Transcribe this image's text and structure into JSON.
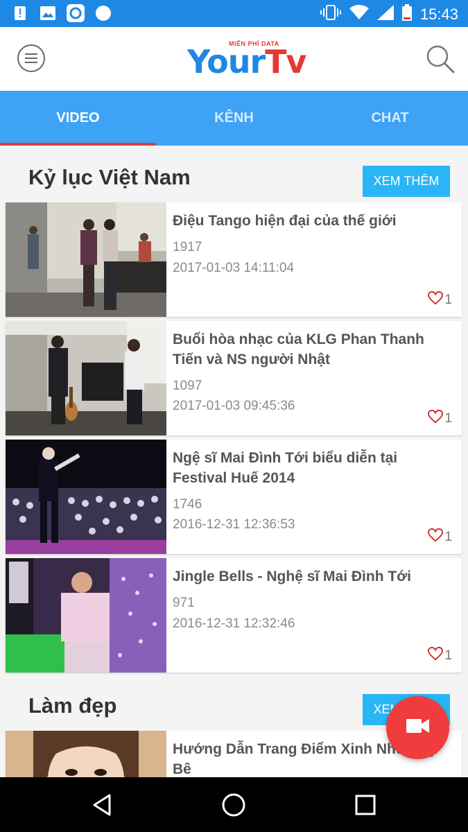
{
  "statusbar": {
    "time": "15:43",
    "left_icons": [
      "alert-icon",
      "image-icon",
      "app-icon",
      "circle-icon"
    ],
    "right_icons": [
      "vibrate-icon",
      "wifi-icon",
      "signal-icon",
      "battery-icon"
    ]
  },
  "appbar": {
    "logo_tag": "MIỄN PHÍ DATA",
    "logo_your": "Your",
    "logo_tv": "Tv"
  },
  "tabs": [
    {
      "label": "VIDEO",
      "active": true
    },
    {
      "label": "KÊNH",
      "active": false
    },
    {
      "label": "CHAT",
      "active": false
    }
  ],
  "sections": [
    {
      "title": "Kỷ lục Việt Nam",
      "more_label": "XEM THÊM",
      "videos": [
        {
          "title": "Điệu Tango hiện đại của thế giới",
          "views": "1917",
          "date": "2017-01-03 14:11:04",
          "likes": "1"
        },
        {
          "title": "Buổi hòa nhạc của KLG Phan Thanh Tiến và NS người Nhật",
          "views": "1097",
          "date": "2017-01-03 09:45:36",
          "likes": "1"
        },
        {
          "title": "Ngệ sĩ Mai Đình Tới biểu diễn tại Festival Huế 2014",
          "views": "1746",
          "date": "2016-12-31 12:36:53",
          "likes": "1"
        },
        {
          "title": "Jingle Bells - Nghệ sĩ Mai Đình Tới",
          "views": "971",
          "date": "2016-12-31 12:32:46",
          "likes": "1"
        }
      ]
    },
    {
      "title": "Làm đẹp",
      "more_label": "XEM THÊM",
      "videos": [
        {
          "title": "Hướng Dẫn Trang Điểm Xinh Như Búp Bê"
        }
      ]
    }
  ],
  "colors": {
    "primary": "#1e88e5",
    "tab_bar": "#3ea2f5",
    "accent": "#e53935",
    "more_button": "#29b6f6",
    "fab": "#f03c3c"
  },
  "icons": {
    "menu": "menu-icon",
    "search": "search-icon",
    "heart": "heart-icon",
    "fab": "video-camera-icon",
    "nav": [
      "back-icon",
      "home-icon",
      "recents-icon"
    ]
  }
}
